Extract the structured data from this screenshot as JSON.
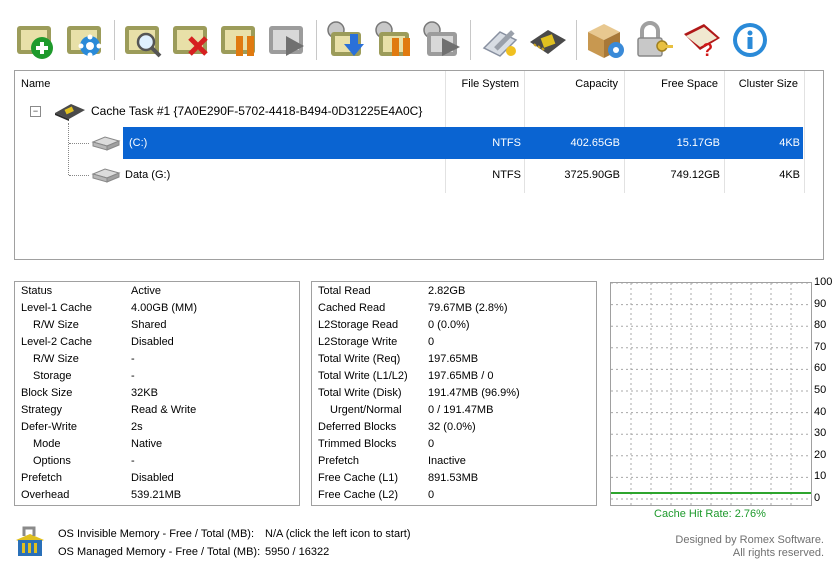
{
  "toolbar": {
    "buttons": [
      {
        "name": "new-task-button",
        "icon": "add-icon"
      },
      {
        "name": "task-settings-button",
        "icon": "gear-icon"
      },
      {
        "name": "view-task-button",
        "icon": "magnifier-icon"
      },
      {
        "name": "delete-task-button",
        "icon": "delete-icon"
      },
      {
        "name": "pause-task-button",
        "icon": "pause-icon"
      },
      {
        "name": "resume-task-button",
        "icon": "play-icon"
      },
      {
        "name": "save-cache-button",
        "icon": "download-icon"
      },
      {
        "name": "pause-all-button",
        "icon": "pause-all-icon"
      },
      {
        "name": "resume-all-button",
        "icon": "resume-all-icon"
      },
      {
        "name": "tools-button",
        "icon": "wrench-icon"
      },
      {
        "name": "chip-settings-button",
        "icon": "chip-icon"
      },
      {
        "name": "package-settings-button",
        "icon": "package-icon"
      },
      {
        "name": "license-button",
        "icon": "key-lock-icon"
      },
      {
        "name": "help-button",
        "icon": "help-book-icon"
      },
      {
        "name": "about-button",
        "icon": "info-icon"
      }
    ]
  },
  "tree": {
    "headers": {
      "name": "Name",
      "fs": "File System",
      "capacity": "Capacity",
      "free": "Free Space",
      "cluster": "Cluster Size"
    },
    "task": {
      "label": "Cache Task #1 {7A0E290F-5702-4418-B494-0D31225E4A0C}"
    },
    "drives": [
      {
        "name": "(C:)",
        "fs": "NTFS",
        "capacity": "402.65GB",
        "free": "15.17GB",
        "cluster": "4KB",
        "selected": true
      },
      {
        "name": "Data (G:)",
        "fs": "NTFS",
        "capacity": "3725.90GB",
        "free": "749.12GB",
        "cluster": "4KB",
        "selected": false
      }
    ]
  },
  "status": [
    {
      "k": "Status",
      "v": "Active",
      "indent": false
    },
    {
      "k": "Level-1 Cache",
      "v": "4.00GB (MM)",
      "indent": false
    },
    {
      "k": "R/W Size",
      "v": "Shared",
      "indent": true
    },
    {
      "k": "Level-2 Cache",
      "v": "Disabled",
      "indent": false
    },
    {
      "k": "R/W Size",
      "v": "-",
      "indent": true
    },
    {
      "k": "Storage",
      "v": "-",
      "indent": true
    },
    {
      "k": "Block Size",
      "v": "32KB",
      "indent": false
    },
    {
      "k": "Strategy",
      "v": "Read & Write",
      "indent": false
    },
    {
      "k": "Defer-Write",
      "v": "2s",
      "indent": false
    },
    {
      "k": "Mode",
      "v": "Native",
      "indent": true
    },
    {
      "k": "Options",
      "v": "-",
      "indent": true
    },
    {
      "k": "Prefetch",
      "v": "Disabled",
      "indent": false
    },
    {
      "k": "Overhead",
      "v": "539.21MB",
      "indent": false
    }
  ],
  "stats": [
    {
      "k": "Total Read",
      "v": "2.82GB",
      "indent": false
    },
    {
      "k": "Cached Read",
      "v": "79.67MB (2.8%)",
      "indent": false
    },
    {
      "k": "L2Storage Read",
      "v": "0 (0.0%)",
      "indent": false
    },
    {
      "k": "L2Storage Write",
      "v": "0",
      "indent": false
    },
    {
      "k": "Total Write (Req)",
      "v": "197.65MB",
      "indent": false
    },
    {
      "k": "Total Write (L1/L2)",
      "v": "197.65MB / 0",
      "indent": false
    },
    {
      "k": "Total Write (Disk)",
      "v": "191.47MB (96.9%)",
      "indent": false
    },
    {
      "k": "Urgent/Normal",
      "v": "0 / 191.47MB",
      "indent": true
    },
    {
      "k": "Deferred Blocks",
      "v": "32 (0.0%)",
      "indent": false
    },
    {
      "k": "Trimmed Blocks",
      "v": "0",
      "indent": false
    },
    {
      "k": "Prefetch",
      "v": "Inactive",
      "indent": false
    },
    {
      "k": "Free Cache (L1)",
      "v": "891.53MB",
      "indent": false
    },
    {
      "k": "Free Cache (L2)",
      "v": "0",
      "indent": false
    }
  ],
  "chart_data": {
    "type": "line",
    "title": "",
    "ylim": [
      0,
      100
    ],
    "yticks": [
      "100",
      "90",
      "80",
      "70",
      "60",
      "50",
      "40",
      "30",
      "20",
      "10",
      "0"
    ],
    "series": [
      {
        "values": [
          2.76,
          2.76,
          2.76,
          2.76,
          2.76,
          2.76,
          2.76,
          2.76,
          2.76,
          2.76
        ]
      }
    ],
    "grid": true,
    "line_color": "#2da52d",
    "caption": "Cache Hit Rate: 2.76%"
  },
  "footer": {
    "invisible_label": "OS Invisible Memory - Free / Total (MB):",
    "invisible_value": "N/A (click the left icon to start)",
    "managed_label": "OS Managed Memory - Free / Total (MB):",
    "managed_value": "5950 / 16322",
    "credit1": "Designed by Romex Software.",
    "credit2": "All rights reserved."
  }
}
